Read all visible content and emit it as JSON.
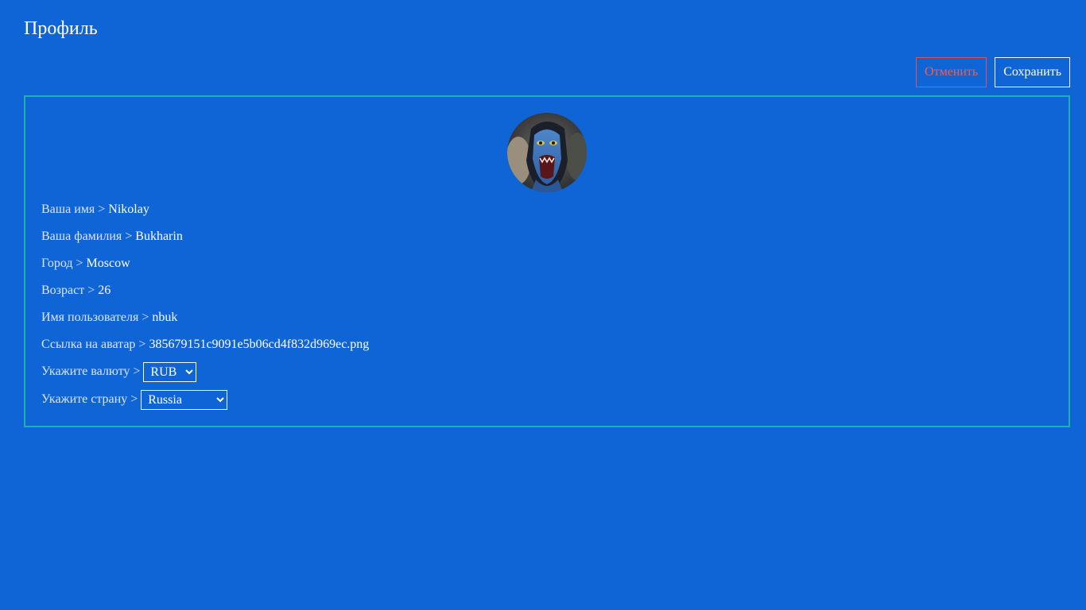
{
  "page": {
    "title": "Профиль"
  },
  "toolbar": {
    "cancel_label": "Отменить",
    "save_label": "Сохранить"
  },
  "profile": {
    "fields": [
      {
        "label": "Ваша имя > ",
        "value": "Nikolay"
      },
      {
        "label": "Ваша фамилия > ",
        "value": "Bukharin"
      },
      {
        "label": "Город > ",
        "value": "Moscow"
      },
      {
        "label": "Возраст > ",
        "value": "26"
      },
      {
        "label": "Имя пользователя > ",
        "value": "nbuk"
      },
      {
        "label": "Ссылка на аватар > ",
        "value": "385679151c9091e5b06cd4f832d969ec.png"
      }
    ],
    "currency": {
      "label": "Укажите валюту > ",
      "selected": "RUB"
    },
    "country": {
      "label": "Укажите страну > ",
      "selected": "Russia"
    }
  },
  "colors": {
    "background": "#1065d6",
    "card_border": "#21b0b0",
    "cancel": "#f25d4e",
    "save": "#ffffff"
  }
}
